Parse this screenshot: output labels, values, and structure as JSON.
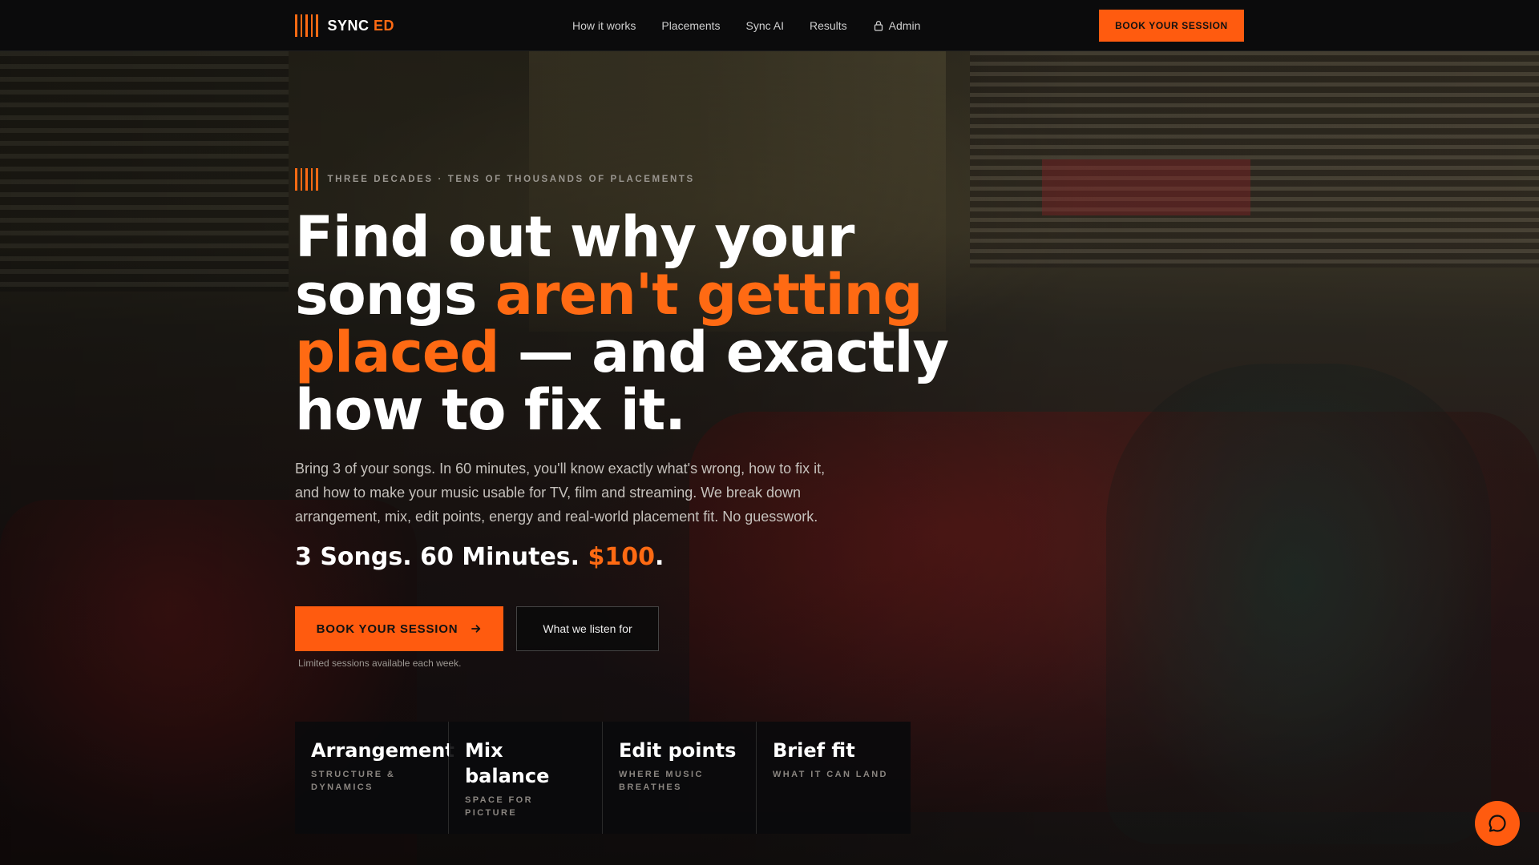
{
  "nav": {
    "logo_text": "SYNC",
    "logo_accent": "ED",
    "links": [
      "How it works",
      "Placements",
      "Sync AI",
      "Results",
      "Admin"
    ],
    "cta": "BOOK YOUR SESSION"
  },
  "hero": {
    "eyebrow": "THREE DECADES · TENS OF THOUSANDS OF PLACEMENTS",
    "headline_1": "Find out why your songs ",
    "headline_hl": "aren't getting placed",
    "headline_2": " — and exactly how to fix it.",
    "lede": "Bring 3 of your songs. In 60 minutes, you'll know exactly what's wrong, how to fix it, and how to make your music usable for TV, film and streaming. We break down arrangement, mix, edit points, energy and real-world placement fit. No guesswork.",
    "price_pre": "3 Songs. 60 Minutes. ",
    "price_hl": "$100",
    "price_post": ".",
    "primary_cta": "BOOK YOUR SESSION",
    "secondary_cta": "What we listen for",
    "note": "Limited sessions available each week."
  },
  "cards": [
    {
      "title": "Arrangement",
      "sub": "STRUCTURE & DYNAMICS"
    },
    {
      "title": "Mix balance",
      "sub": "SPACE FOR PICTURE"
    },
    {
      "title": "Edit points",
      "sub": "WHERE MUSIC BREATHES"
    },
    {
      "title": "Brief fit",
      "sub": "WHAT IT CAN LAND"
    }
  ],
  "colors": {
    "accent": "#ff6a13",
    "background": "#0b0b0c"
  },
  "icons": [
    "logo-bars-icon",
    "lock-icon",
    "arrow-right-icon",
    "chat-icon"
  ]
}
